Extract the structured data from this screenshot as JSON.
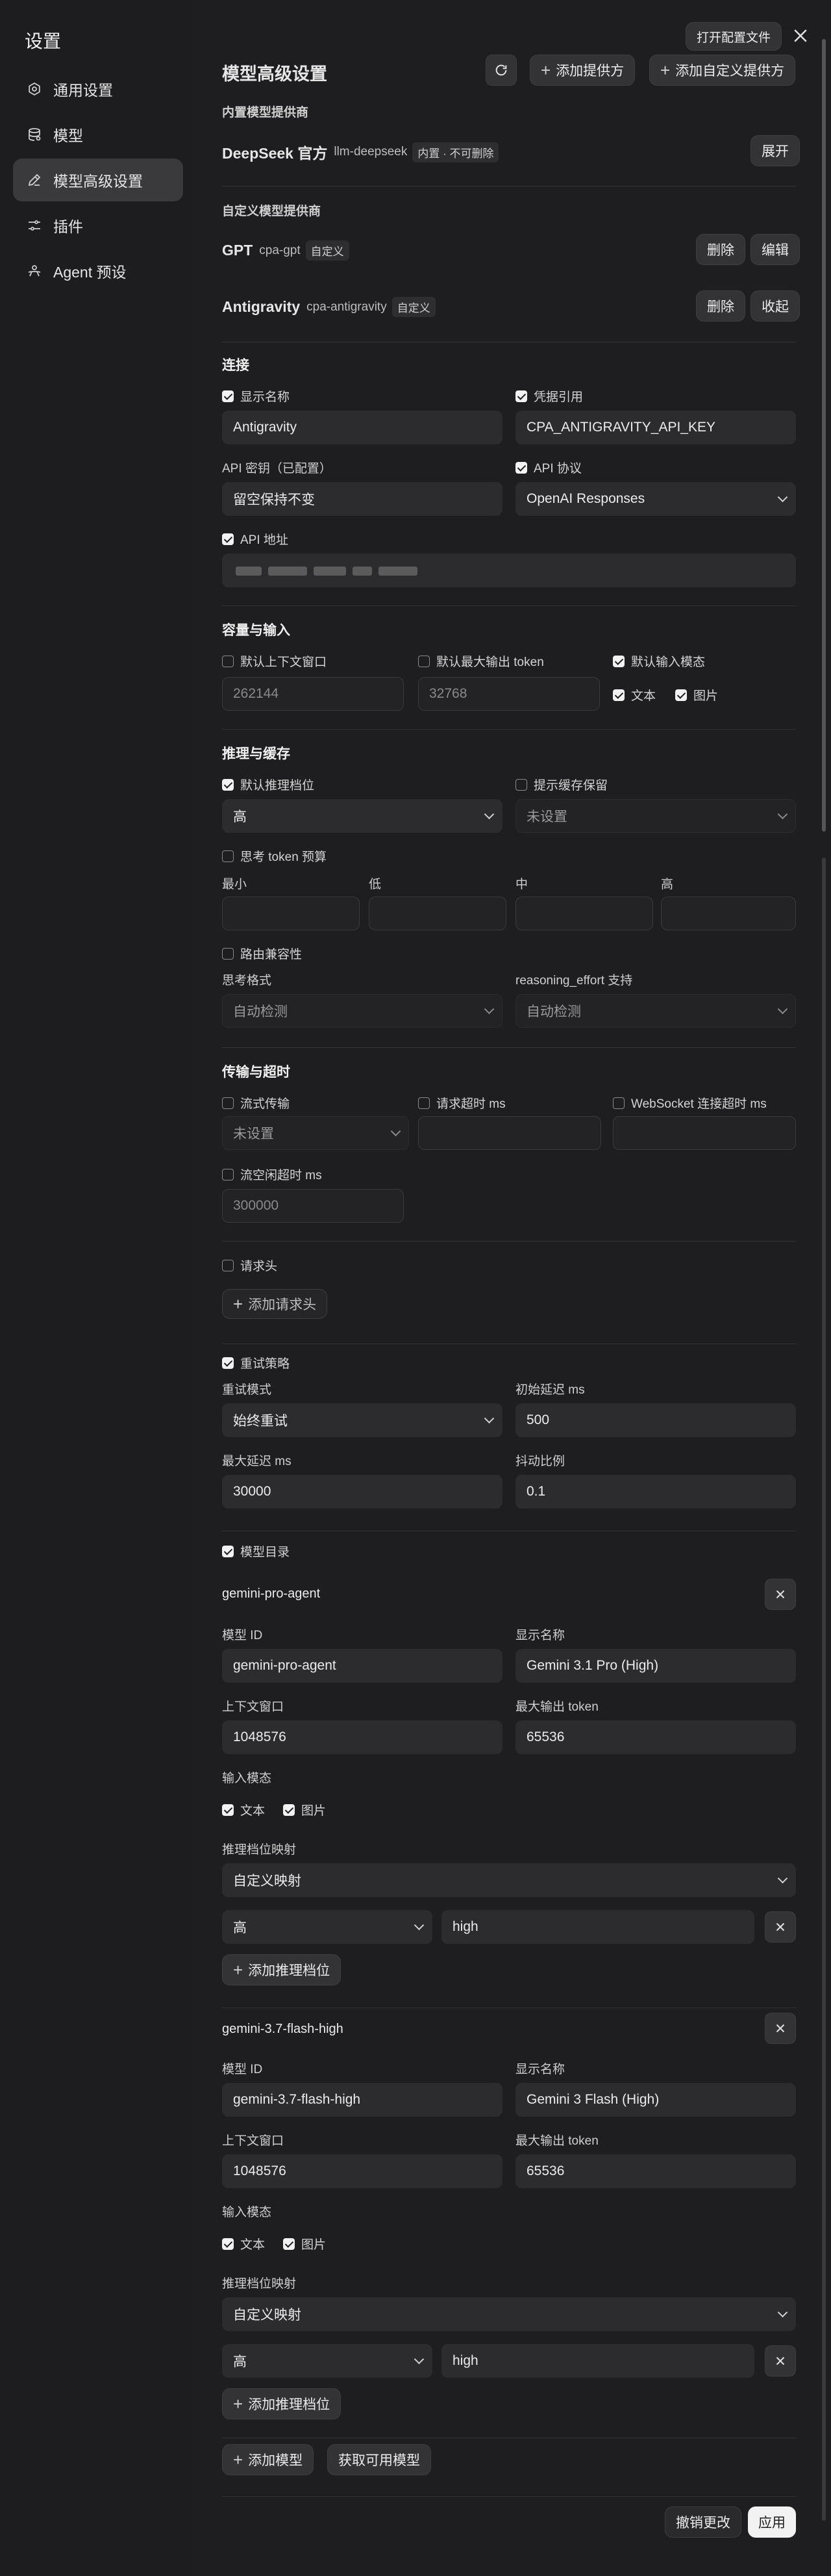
{
  "sidebar": {
    "title": "设置",
    "items": [
      {
        "label": "通用设置",
        "icon": "gear-icon"
      },
      {
        "label": "模型",
        "icon": "model-icon"
      },
      {
        "label": "模型高级设置",
        "icon": "edit-icon"
      },
      {
        "label": "插件",
        "icon": "sliders-icon"
      },
      {
        "label": "Agent 预设",
        "icon": "agent-icon"
      }
    ]
  },
  "top": {
    "open_config": "打开配置文件"
  },
  "header": {
    "title": "模型高级设置",
    "add_provider": "添加提供方",
    "add_custom_provider": "添加自定义提供方"
  },
  "builtin": {
    "section": "内置模型提供商",
    "name": "DeepSeek 官方",
    "id": "llm-deepseek",
    "tag": "内置 · 不可删除",
    "expand": "展开"
  },
  "custom": {
    "section": "自定义模型提供商",
    "gpt": {
      "name": "GPT",
      "id": "cpa-gpt",
      "tag": "自定义",
      "delete": "删除",
      "edit": "编辑"
    },
    "antigravity": {
      "name": "Antigravity",
      "id": "cpa-antigravity",
      "tag": "自定义",
      "delete": "删除",
      "collapse": "收起"
    }
  },
  "connection": {
    "section": "连接",
    "show_name": "显示名称",
    "show_name_value": "Antigravity",
    "cred_ref": "凭据引用",
    "cred_ref_value": "CPA_ANTIGRAVITY_API_KEY",
    "api_key": "API 密钥（已配置）",
    "api_key_placeholder": "留空保持不变",
    "api_protocol": "API 协议",
    "api_protocol_value": "OpenAI Responses",
    "api_url": "API 地址"
  },
  "capacity": {
    "section": "容量与输入",
    "default_ctx": "默认上下文窗口",
    "default_ctx_ph": "262144",
    "default_max_out": "默认最大输出 token",
    "default_max_out_ph": "32768",
    "default_modality": "默认输入模态",
    "text": "文本",
    "image": "图片"
  },
  "reasoning": {
    "section": "推理与缓存",
    "default_level": "默认推理档位",
    "default_level_value": "高",
    "cache_keep": "提示缓存保留",
    "cache_keep_value": "未设置",
    "budget": "思考 token 预算",
    "min": "最小",
    "low": "低",
    "mid": "中",
    "high": "高",
    "route_compat": "路由兼容性",
    "think_format": "思考格式",
    "think_format_value": "自动检测",
    "effort_support": "reasoning_effort 支持",
    "effort_support_value": "自动检测"
  },
  "transport": {
    "section": "传输与超时",
    "stream": "流式传输",
    "stream_value": "未设置",
    "req_timeout": "请求超时 ms",
    "ws_timeout": "WebSocket 连接超时 ms",
    "idle_timeout": "流空闲超时 ms",
    "idle_timeout_ph": "300000"
  },
  "headers": {
    "label": "请求头",
    "add": "添加请求头"
  },
  "retry": {
    "label": "重试策略",
    "mode": "重试模式",
    "mode_value": "始终重试",
    "init_delay": "初始延迟 ms",
    "init_delay_value": "500",
    "max_delay": "最大延迟 ms",
    "max_delay_value": "30000",
    "jitter": "抖动比例",
    "jitter_value": "0.1"
  },
  "catalog": {
    "label": "模型目录",
    "models": [
      {
        "name": "gemini-pro-agent",
        "id_label": "模型 ID",
        "id_value": "gemini-pro-agent",
        "disp_label": "显示名称",
        "disp_value": "Gemini 3.1 Pro (High)",
        "ctx_label": "上下文窗口",
        "ctx_value": "1048576",
        "out_label": "最大输出 token",
        "out_value": "65536",
        "modality": "输入模态",
        "text": "文本",
        "image": "图片",
        "map_label": "推理档位映射",
        "map_value": "自定义映射",
        "level": "高",
        "level_map": "high",
        "add_level": "添加推理档位"
      },
      {
        "name": "gemini-3.7-flash-high",
        "id_label": "模型 ID",
        "id_value": "gemini-3.7-flash-high",
        "disp_label": "显示名称",
        "disp_value": "Gemini 3 Flash (High)",
        "ctx_label": "上下文窗口",
        "ctx_value": "1048576",
        "out_label": "最大输出 token",
        "out_value": "65536",
        "modality": "输入模态",
        "text": "文本",
        "image": "图片",
        "map_label": "推理档位映射",
        "map_value": "自定义映射",
        "level": "高",
        "level_map": "high",
        "add_level": "添加推理档位"
      }
    ],
    "add_model": "添加模型",
    "fetch_models": "获取可用模型"
  },
  "footer": {
    "cancel": "撤销更改",
    "apply": "应用"
  },
  "colors": {
    "bg": "#1e1e20",
    "sidebar": "#1d1d1f",
    "input": "#2c2c2f",
    "accent": "#f2f2f2"
  }
}
